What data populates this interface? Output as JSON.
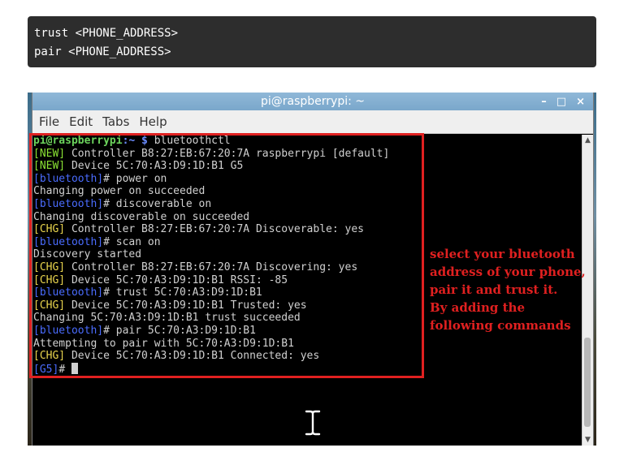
{
  "code_block": {
    "lines": [
      "trust <PHONE_ADDRESS>",
      "pair <PHONE_ADDRESS>"
    ]
  },
  "window": {
    "title": "pi@raspberrypi: ~",
    "buttons": {
      "minimize": "–",
      "maximize": "□",
      "close": "×"
    }
  },
  "menu": [
    "File",
    "Edit",
    "Tabs",
    "Help"
  ],
  "terminal": {
    "prompt_user": "pi@raspberrypi",
    "prompt_path": ":~ $",
    "command": " bluetoothctl",
    "lines": [
      {
        "tag": "[NEW]",
        "text": " Controller B8:27:EB:67:20:7A raspberrypi [default]"
      },
      {
        "tag": "[NEW]",
        "text": " Device 5C:70:A3:D9:1D:B1 G5"
      },
      {
        "tag": "[bluetooth]",
        "text": "# power on"
      },
      {
        "tag": "",
        "text": "Changing power on succeeded"
      },
      {
        "tag": "[bluetooth]",
        "text": "# discoverable on"
      },
      {
        "tag": "",
        "text": "Changing discoverable on succeeded"
      },
      {
        "tag": "[CHG]",
        "text": " Controller B8:27:EB:67:20:7A Discoverable: yes"
      },
      {
        "tag": "[bluetooth]",
        "text": "# scan on"
      },
      {
        "tag": "",
        "text": "Discovery started"
      },
      {
        "tag": "[CHG]",
        "text": " Controller B8:27:EB:67:20:7A Discovering: yes"
      },
      {
        "tag": "[CHG]",
        "text": " Device 5C:70:A3:D9:1D:B1 RSSI: -85"
      },
      {
        "tag": "[bluetooth]",
        "text": "# trust 5C:70:A3:D9:1D:B1"
      },
      {
        "tag": "[CHG]",
        "text": " Device 5C:70:A3:D9:1D:B1 Trusted: yes"
      },
      {
        "tag": "",
        "text": "Changing 5C:70:A3:D9:1D:B1 trust succeeded"
      },
      {
        "tag": "[bluetooth]",
        "text": "# pair 5C:70:A3:D9:1D:B1"
      },
      {
        "tag": "",
        "text": "Attempting to pair with 5C:70:A3:D9:1D:B1"
      },
      {
        "tag": "[CHG]",
        "text": " Device 5C:70:A3:D9:1D:B1 Connected: yes"
      },
      {
        "tag": "[G5]",
        "text": "# "
      }
    ]
  },
  "annotation": {
    "lines": [
      "select your bluetooth",
      "address of your phone,",
      "pair it and trust it.",
      "By adding the",
      "following commands"
    ]
  },
  "colors": {
    "highlight": "#e02020",
    "tag_new": "#8ae234",
    "tag_bluetooth": "#4a6cff",
    "tag_chg": "#e8d44d"
  },
  "icons": {
    "mouse_cursor": "text-cursor-icon"
  }
}
